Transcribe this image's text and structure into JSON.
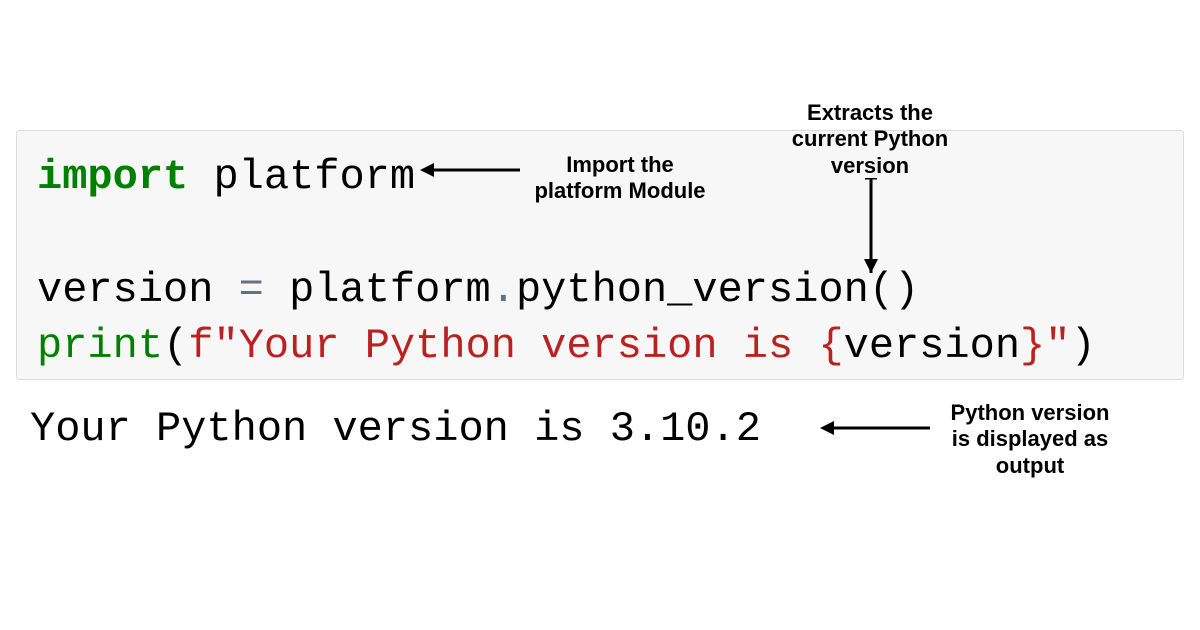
{
  "code": {
    "line1": {
      "keyword": "import",
      "space1": " ",
      "module": "platform"
    },
    "line2": {
      "varname": "version",
      "space1": " ",
      "equals": "=",
      "space2": " ",
      "obj": "platform",
      "dot": ".",
      "func": "python_version",
      "lparen": "(",
      "rparen": ")"
    },
    "line3": {
      "print": "print",
      "lparen": "(",
      "fprefix": "f",
      "quote1": "\"",
      "strtext": "Your Python version is ",
      "lbrace": "{",
      "interpvar": "version",
      "rbrace": "}",
      "quote2": "\"",
      "rparen": ")"
    }
  },
  "output": "Your Python version is 3.10.2",
  "annotations": {
    "import_label": "Import the\nplatform Module",
    "extract_label": "Extracts the\ncurrent Python\nversion",
    "output_label": "Python version\nis displayed as\noutput"
  }
}
